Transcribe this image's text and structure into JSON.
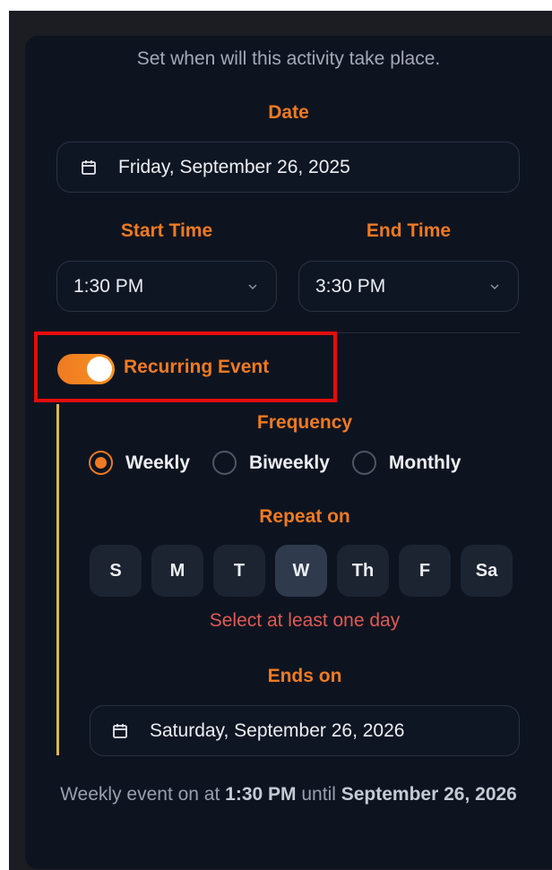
{
  "schedule": {
    "subtitle": "Set when will this activity take place.",
    "date_label": "Date",
    "date_value": "Friday, September 26, 2025",
    "start_label": "Start Time",
    "start_value": "1:30 PM",
    "end_label": "End Time",
    "end_value": "3:30 PM"
  },
  "recurring": {
    "label": "Recurring Event",
    "enabled": true,
    "frequency_label": "Frequency",
    "frequency_options": [
      "Weekly",
      "Biweekly",
      "Monthly"
    ],
    "selected_frequency": "Weekly",
    "repeat_label": "Repeat on",
    "days": [
      "S",
      "M",
      "T",
      "W",
      "Th",
      "F",
      "Sa"
    ],
    "error": "Select at least one day",
    "ends_label": "Ends on",
    "ends_value": "Saturday, September 26, 2026"
  },
  "summary": {
    "prefix": "Weekly event on at ",
    "time": "1:30 PM",
    "middle": " until ",
    "until_date": "September 26, 2026"
  },
  "icons": {
    "calendar": "calendar-icon",
    "chevron": "chevron-down-icon"
  },
  "colors": {
    "accent": "#f07a22",
    "error": "#e05a55",
    "highlight": "#e30d0d",
    "side_line": "#e1b553"
  }
}
